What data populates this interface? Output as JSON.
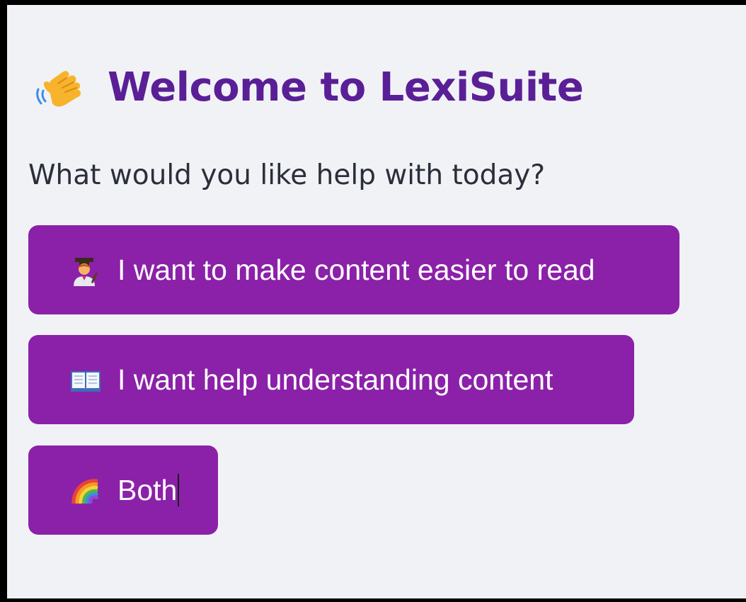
{
  "header": {
    "icon": "waving-hand-icon",
    "title": "Welcome to LexiSuite"
  },
  "prompt": "What would you like help with today?",
  "options": [
    {
      "icon": "teacher-icon",
      "label": "I want to make content easier to read"
    },
    {
      "icon": "open-book-icon",
      "label": "I want help understanding content"
    },
    {
      "icon": "rainbow-icon",
      "label": "Both"
    }
  ],
  "colors": {
    "background": "#f1f2f6",
    "title": "#5a1f96",
    "button": "#8b21a8",
    "button_text": "#ffffff",
    "prompt_text": "#2a2f3a"
  }
}
